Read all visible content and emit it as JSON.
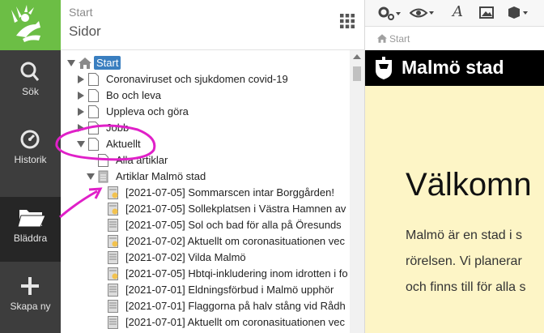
{
  "rail": {
    "items": [
      {
        "label": "Sök",
        "icon": "search-icon"
      },
      {
        "label": "Historik",
        "icon": "history-icon"
      },
      {
        "label": "Bläddra",
        "icon": "folder-icon"
      },
      {
        "label": "Skapa ny",
        "icon": "plus-icon"
      }
    ],
    "logo_color": "#6cbe45"
  },
  "panel": {
    "crumb": "Start",
    "title": "Sidor"
  },
  "tree": {
    "root": "Start",
    "items": [
      {
        "label": "Coronaviruset och sjukdomen covid-19"
      },
      {
        "label": "Bo och leva"
      },
      {
        "label": "Uppleva och göra"
      },
      {
        "label": "Jobb"
      },
      {
        "label": "Aktuellt"
      },
      {
        "label": "Alla artiklar"
      },
      {
        "label": "Artiklar Malmö stad"
      },
      {
        "label": "[2021-07-05] Sommarscen intar Borggården!"
      },
      {
        "label": "[2021-07-05] Sollekplatsen i Västra Hamnen av"
      },
      {
        "label": "[2021-07-05] Sol och bad för alla på Öresunds"
      },
      {
        "label": "[2021-07-02] Aktuellt om coronasituationen vec"
      },
      {
        "label": "[2021-07-02] Vilda Malmö"
      },
      {
        "label": "[2021-07-05] Hbtqi-inkludering inom idrotten i fo"
      },
      {
        "label": "[2021-07-01] Eldningsförbud i Malmö upphör"
      },
      {
        "label": "[2021-07-01] Flaggorna på halv stång vid Rådh"
      },
      {
        "label": "[2021-07-01] Aktuellt om coronasituationen vec"
      }
    ]
  },
  "preview": {
    "breadcrumb": "Start",
    "site_name": "Malmö stad",
    "welcome": "Välkomn",
    "para": [
      "Malmö är en stad i s",
      "rörelsen. Vi planerar",
      "och finns till för alla s"
    ],
    "header_color": "#000000",
    "body_color": "#fdf5c6"
  },
  "annotation_color": "#e020c8"
}
